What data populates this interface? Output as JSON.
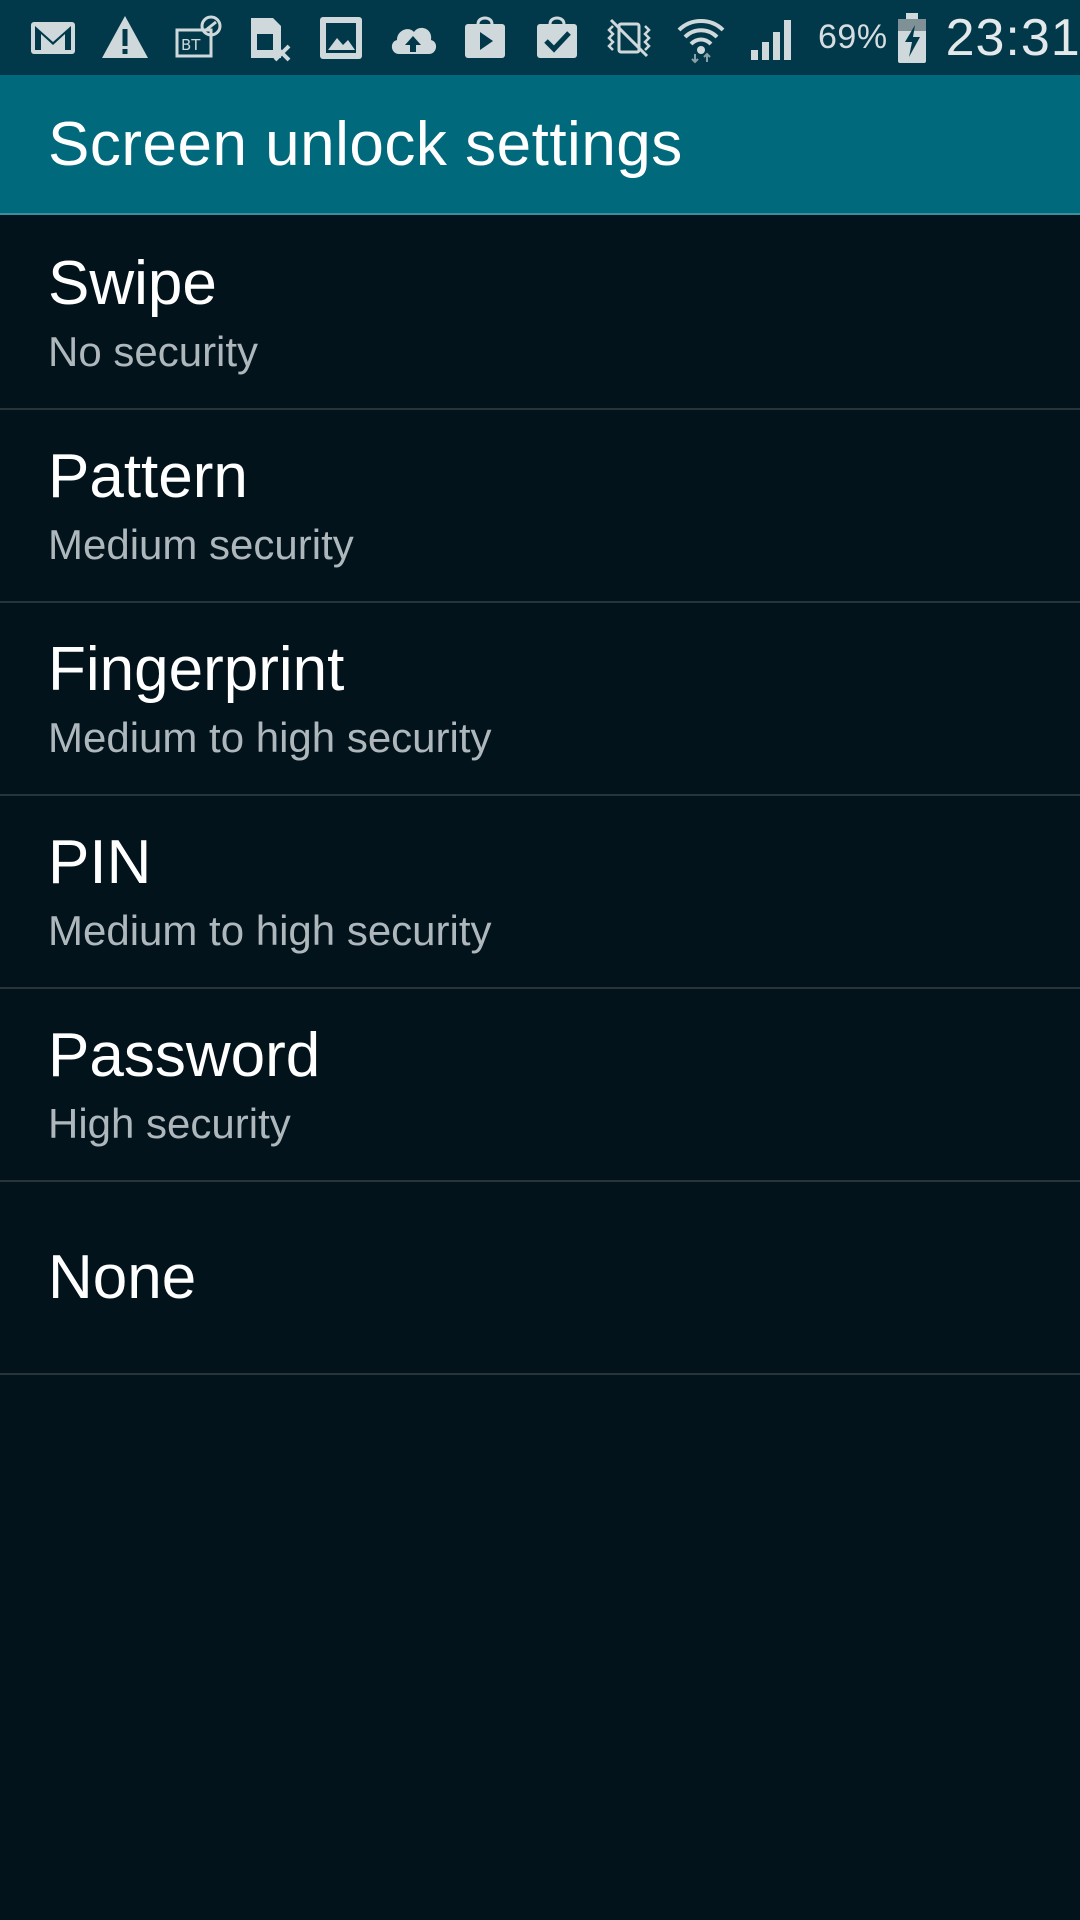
{
  "status_bar": {
    "battery_percent": "69%",
    "time": "23:31",
    "icons": [
      "gmail-icon",
      "warning-icon",
      "sim-icon",
      "sim-blocked-icon",
      "gallery-icon",
      "cloud-upload-icon",
      "play-store-icon",
      "shopping-bag-check-icon",
      "vibrate-mute-icon",
      "wifi-icon",
      "signal-icon",
      "battery-charging-icon"
    ]
  },
  "header": {
    "title": "Screen unlock settings"
  },
  "options": [
    {
      "title": "Swipe",
      "subtitle": "No security"
    },
    {
      "title": "Pattern",
      "subtitle": "Medium security"
    },
    {
      "title": "Fingerprint",
      "subtitle": "Medium to high security"
    },
    {
      "title": "PIN",
      "subtitle": "Medium to high security"
    },
    {
      "title": "Password",
      "subtitle": "High security"
    },
    {
      "title": "None",
      "subtitle": ""
    }
  ],
  "colors": {
    "status_bar": "#02394a",
    "action_bar": "#00697c",
    "background": "#02131b"
  }
}
